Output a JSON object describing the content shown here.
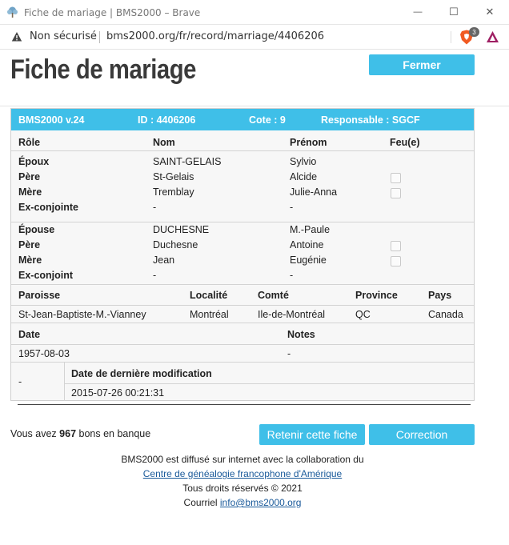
{
  "window": {
    "title": "Fiche de mariage | BMS2000 – Brave",
    "minimize_glyph": "—",
    "maximize_glyph": "☐",
    "close_glyph": "✕"
  },
  "address": {
    "security": "Non sécurisé",
    "url": "bms2000.org/fr/record/marriage/4406206",
    "shield_count": "3"
  },
  "page": {
    "title": "Fiche de mariage",
    "close_button": "Fermer"
  },
  "record_header": {
    "version": "BMS2000 v.24",
    "id": "ID : 4406206",
    "cote": "Cote : 9",
    "responsable": "Responsable : SGCF"
  },
  "columns": {
    "role": "Rôle",
    "nom": "Nom",
    "prenom": "Prénom",
    "feu": "Feu(e)"
  },
  "groom": [
    {
      "role": "Époux",
      "nom": "SAINT-GELAIS",
      "prenom": "Sylvio",
      "deceased_checkbox": false
    },
    {
      "role": "Père",
      "nom": "St-Gelais",
      "prenom": "Alcide",
      "deceased_checkbox": true
    },
    {
      "role": "Mère",
      "nom": "Tremblay",
      "prenom": "Julie-Anna",
      "deceased_checkbox": true
    },
    {
      "role": "Ex-conjointe",
      "nom": "-",
      "prenom": "-",
      "deceased_checkbox": false
    }
  ],
  "bride": [
    {
      "role": "Épouse",
      "nom": "DUCHESNE",
      "prenom": "M.-Paule",
      "deceased_checkbox": false
    },
    {
      "role": "Père",
      "nom": "Duchesne",
      "prenom": "Antoine",
      "deceased_checkbox": true
    },
    {
      "role": "Mère",
      "nom": "Jean",
      "prenom": "Eugénie",
      "deceased_checkbox": true
    },
    {
      "role": "Ex-conjoint",
      "nom": "-",
      "prenom": "-",
      "deceased_checkbox": false
    }
  ],
  "place": {
    "headers": {
      "paroisse": "Paroisse",
      "localite": "Localité",
      "comte": "Comté",
      "province": "Province",
      "pays": "Pays"
    },
    "values": {
      "paroisse": "St-Jean-Baptiste-M.-Vianney",
      "localite": "Montréal",
      "comte": "Ile-de-Montréal",
      "province": "QC",
      "pays": "Canada"
    }
  },
  "date_notes": {
    "date_label": "Date",
    "notes_label": "Notes",
    "date_value": "1957-08-03",
    "notes_value": "-"
  },
  "modification": {
    "left_value": "-",
    "label": "Date de dernière modification",
    "value": "2015-07-26 00:21:31"
  },
  "bank": {
    "prefix": "Vous avez",
    "count": "967",
    "suffix": "bons en banque"
  },
  "buttons": {
    "retain": "Retenir cette fiche",
    "correction": "Correction"
  },
  "footer": {
    "line1": "BMS2000 est diffusé sur internet avec la collaboration du",
    "link": "Centre de généalogie francophone d'Amérique",
    "rights": "Tous droits réservés © 2021",
    "mail_prefix": "Courriel",
    "mail": "info@bms2000.org"
  },
  "colors": {
    "accent": "#3fbfe8",
    "link": "#1a5a9a"
  }
}
